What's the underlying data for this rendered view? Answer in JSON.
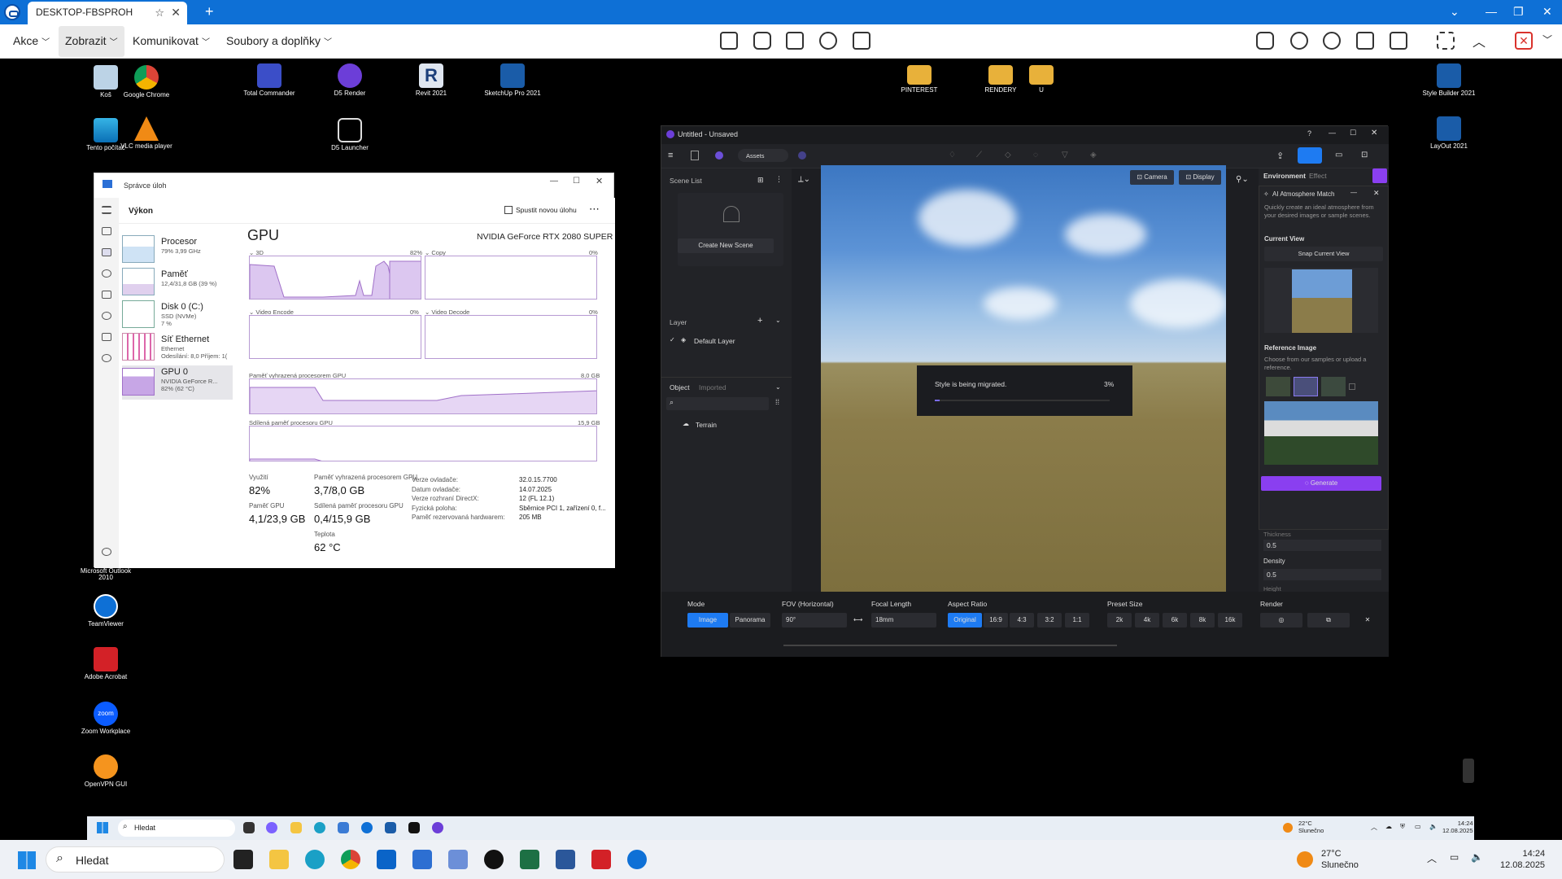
{
  "teamviewer": {
    "tab_title": "DESKTOP-FBSPROH",
    "menus": [
      "Akce",
      "Zobrazit",
      "Komunikovat",
      "Soubory a doplňky"
    ]
  },
  "desktop_icons": {
    "left": [
      {
        "label": "Koš",
        "icon": "recycle-bin-icon"
      },
      {
        "label": "Google Chrome",
        "icon": "chrome-icon"
      },
      {
        "label": "Total Commander",
        "icon": "floppy-icon"
      },
      {
        "label": "D5 Render",
        "icon": "d5-icon"
      },
      {
        "label": "Revit 2021",
        "icon": "revit-icon"
      },
      {
        "label": "SketchUp Pro 2021",
        "icon": "sketchup-icon"
      },
      {
        "label": "Tento počítač",
        "icon": "monitor-icon"
      },
      {
        "label": "VLC media player",
        "icon": "vlc-icon"
      },
      {
        "label": "D5 Launcher",
        "icon": "d5-launcher-icon"
      },
      {
        "label": "Microsoft Outlook 2010",
        "icon": "outlook-icon"
      },
      {
        "label": "TeamViewer",
        "icon": "teamviewer-icon"
      },
      {
        "label": "Adobe Acrobat",
        "icon": "acrobat-icon"
      },
      {
        "label": "Zoom Workplace",
        "icon": "zoom-icon"
      },
      {
        "label": "OpenVPN GUI",
        "icon": "openvpn-icon"
      }
    ],
    "folders": [
      {
        "label": "PINTEREST"
      },
      {
        "label": "RENDERY"
      },
      {
        "label": "U"
      }
    ],
    "right": [
      {
        "label": "Style Builder 2021"
      },
      {
        "label": "LayOut 2021"
      }
    ]
  },
  "task_manager": {
    "title": "Správce úloh",
    "header": "Výkon",
    "new_task": "Spustit novou úlohu",
    "resources": [
      {
        "name": "Procesor",
        "sub": "79% 3,99 GHz"
      },
      {
        "name": "Paměť",
        "sub": "12,4/31,8 GB (39 %)"
      },
      {
        "name": "Disk 0 (C:)",
        "sub": "SSD (NVMe)\n7 %"
      },
      {
        "name": "Síť Ethernet",
        "sub": "Ethernet\nOdesílání: 8,0 Příjem: 1("
      },
      {
        "name": "GPU 0",
        "sub": "NVIDIA GeForce R...\n82% (62 °C)"
      }
    ],
    "gpu_title": "GPU",
    "gpu_model": "NVIDIA GeForce RTX 2080 SUPER",
    "graphs": {
      "g3d": {
        "label": "3D",
        "pct": "82%"
      },
      "copy": {
        "label": "Copy",
        "pct": "0%"
      },
      "venc": {
        "label": "Video Encode",
        "pct": "0%"
      },
      "vdec": {
        "label": "Video Decode",
        "pct": "0%"
      },
      "dedicated": {
        "label": "Paměť vyhrazená procesorem GPU",
        "max": "8,0 GB"
      },
      "shared": {
        "label": "Sdílená paměť procesoru GPU",
        "max": "15,9 GB"
      }
    },
    "stats": {
      "util_label": "Využití",
      "util": "82%",
      "ded_label": "Paměť vyhrazená procesorem GPU",
      "ded": "3,7/8,0 GB",
      "gpu_mem_label": "Paměť GPU",
      "gpu_mem": "4,1/23,9 GB",
      "shared_label": "Sdílená paměť procesoru GPU",
      "shared": "0,4/15,9 GB",
      "temp_label": "Teplota",
      "temp": "62 °C",
      "info_labels": [
        "Verze ovladače:",
        "Datum ovladače:",
        "Verze rozhraní DirectX:",
        "Fyzická poloha:",
        "Paměť rezervovaná hardwarem:"
      ],
      "info_values": [
        "32.0.15.7700",
        "14.07.2025",
        "12 (FL 12.1)",
        "Sběrnice PCI 1, zařízení 0, f...",
        "205 MB"
      ]
    }
  },
  "d5": {
    "title": "Untitled - Unsaved",
    "assets": "Assets",
    "scene_list": "Scene List",
    "create_scene": "Create New Scene",
    "layer": "Layer",
    "default_layer": "Default Layer",
    "object_tab": "Object",
    "imported_tab": "Imported",
    "terrain": "Terrain",
    "camera_btn": "Camera",
    "display_btn": "Display",
    "migrate_text": "Style is being migrated.",
    "migrate_pct": "3%",
    "migrate_progress": 0.03,
    "env_tab": "Environment",
    "effect_tab": "Effect",
    "ai_title": "AI Atmosphere Match",
    "ai_desc": "Quickly create an ideal atmosphere from your desired images or sample scenes.",
    "current_view": "Current View",
    "snap_view": "Snap Current View",
    "ref_image": "Reference Image",
    "ref_desc": "Choose from our samples or upload a reference.",
    "generate": "Generate",
    "thickness": "Thickness",
    "thickness_val": "0.5",
    "density": "Density",
    "density_val": "0.5",
    "height": "Height",
    "bottom": {
      "mode": "Mode",
      "image": "Image",
      "panorama": "Panorama",
      "fov": "FOV (Horizontal)",
      "fov_val": "90°",
      "focal": "Focal Length",
      "focal_val": "18mm",
      "aspect": "Aspect Ratio",
      "aspect_opts": [
        "Original",
        "16:9",
        "4:3",
        "3:2",
        "1:1"
      ],
      "preset": "Preset Size",
      "preset_opts": [
        "2k",
        "4k",
        "6k",
        "8k",
        "16k"
      ],
      "render": "Render"
    }
  },
  "inner_taskbar": {
    "search": "Hledat",
    "weather_temp": "22°C",
    "weather_desc": "Slunečno",
    "time": "14:24",
    "date": "12.08.2025"
  },
  "outer_taskbar": {
    "search": "Hledat",
    "weather_temp": "27°C",
    "weather_desc": "Slunečno",
    "time": "14:24",
    "date": "12.08.2025"
  }
}
